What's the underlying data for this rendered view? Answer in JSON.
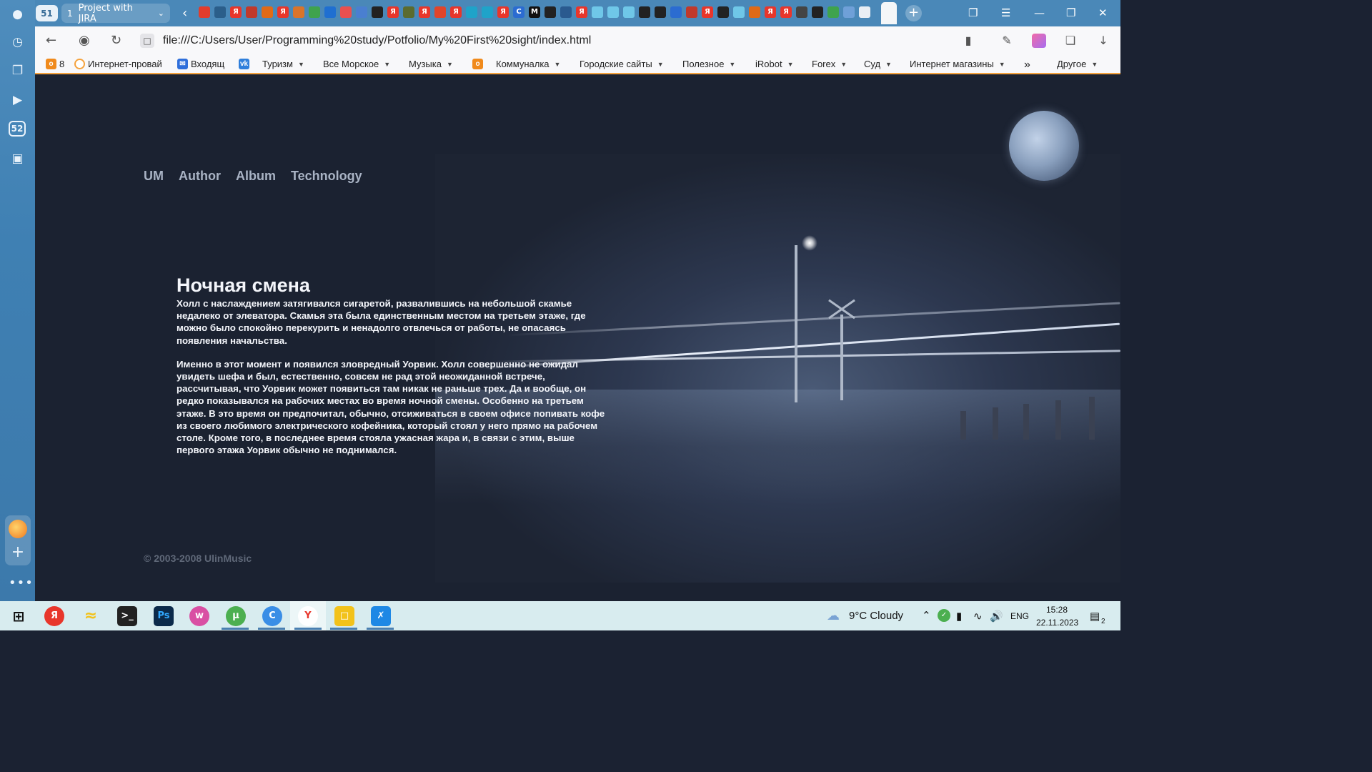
{
  "browser": {
    "tab_count": "51",
    "active_tab": {
      "number": "1",
      "title": "Project with JIRA"
    },
    "url": "file:///C:/Users/User/Programming%20study/Potfolio/My%20First%20sight/index.html",
    "sidebar_badge": "52",
    "bookmarks": [
      {
        "label": "8",
        "icon": "odnoklassniki-icon",
        "color": "#f08a1c",
        "has_menu": false
      },
      {
        "label": "Интернет-провай",
        "icon": "provider-icon",
        "color": "#f5a23c",
        "has_menu": false
      },
      {
        "label": "Входящ",
        "icon": "mail-icon",
        "color": "#2f6fdb",
        "has_menu": false
      },
      {
        "label": "",
        "icon": "vk-icon",
        "color": "#2f7fdb",
        "has_menu": false
      },
      {
        "label": "Туризм",
        "icon": "",
        "color": "",
        "has_menu": true
      },
      {
        "label": "Все Морское",
        "icon": "",
        "color": "",
        "has_menu": true
      },
      {
        "label": "Музыка",
        "icon": "",
        "color": "",
        "has_menu": true
      },
      {
        "label": "",
        "icon": "odnoklassniki-icon",
        "color": "#f08a1c",
        "has_menu": false
      },
      {
        "label": "Коммуналка",
        "icon": "",
        "color": "",
        "has_menu": true
      },
      {
        "label": "Городские сайты",
        "icon": "",
        "color": "",
        "has_menu": true
      },
      {
        "label": "Полезное",
        "icon": "",
        "color": "",
        "has_menu": true
      },
      {
        "label": "iRobot",
        "icon": "",
        "color": "",
        "has_menu": true
      },
      {
        "label": "Forex",
        "icon": "",
        "color": "",
        "has_menu": true
      },
      {
        "label": "Суд",
        "icon": "",
        "color": "",
        "has_menu": true
      },
      {
        "label": "Интернет магазины",
        "icon": "",
        "color": "",
        "has_menu": true
      }
    ],
    "bookmarks_more": "»",
    "bookmarks_other": "Другое"
  },
  "site": {
    "nav": [
      "UM",
      "Author",
      "Album",
      "Technology"
    ],
    "title": "Ночная смена",
    "paragraphs": [
      "Холл с наслаждением затягивался сигаретой, развалившись на небольшой скамье недалеко от элеватора. Скамья эта была единственным местом на третьем этаже, где можно было спокойно перекурить и ненадолго отвлечься от работы, не опасаясь появления начальства.",
      "Именно в этот момент и появился зловредный Уорвик. Холл совершенно не ожидал увидеть шефа и был, естественно, совсем не рад этой неожиданной встрече, рассчитывая, что Уорвик может появиться там никак не раньше трех. Да и вообще, он редко показывался на рабочих местах во время ночной смены. Особенно на третьем этаже. В это время он предпочитал, обычно, отсиживаться в своем офисе попивать кофе из своего любимого электрического кофейника, который стоял у него прямо на рабочем столе. Кроме того, в последнее время стояла ужасная жара и, в связи с этим, выше первого этажа Уорвик обычно не поднимался."
    ],
    "copyright": "© 2003-2008 UlinMusic"
  },
  "taskbar": {
    "weather": "9°C  Cloudy",
    "language": "ENG",
    "time": "15:28",
    "date": "22.11.2023",
    "notifications": "2"
  },
  "colors": {
    "tab_strip": "#4a88b8",
    "page_bg": "#1b2231",
    "nav_link": "#a9b3c4",
    "bookmark_accent": "#f5a23c"
  }
}
